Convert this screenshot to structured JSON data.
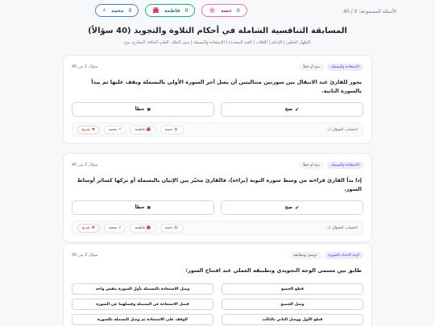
{
  "header": {
    "counter": "الأسئلة المسموعة: 0 / 40",
    "scores": [
      {
        "name": "محمد",
        "score": "0",
        "icon": "⚡",
        "cls": "pill-mohammed"
      },
      {
        "name": "فاطمة",
        "score": "0",
        "icon": "🌺",
        "cls": "pill-fatima"
      },
      {
        "name": "حصة",
        "score": "0",
        "icon": "🌸",
        "cls": "pill-hessa"
      }
    ]
  },
  "title": "المسابقة التنافسية الشاملة في أحكام التلاوة والتجويد (40 سؤالاً)",
  "subtitle": "الإظهار الحلقي | الإدغام | الإقلاب | الغنة المشددة | الاستعاذة والبسملة | سور الملك، القلم، الحاقة، المعارج، نوح",
  "award": {
    "label": "احتساب السؤال لـ:",
    "buttons": [
      {
        "label": "حصة",
        "icon": "🌸"
      },
      {
        "label": "فاطمة",
        "icon": "🌺"
      },
      {
        "label": "محمد",
        "icon": "⚡"
      },
      {
        "label": "تفريغ",
        "icon": "✖"
      }
    ]
  },
  "questions": [
    {
      "num": "سؤال 1 من 40",
      "category": "الاستعاذة والبسملة",
      "type": "صح أو خطأ",
      "text": "يجوز للقارئ عند الانتقال بين سورتين متتاليتين أن يصل آخر السورة الأولى بالبسملة ويقف عليها ثم يبدأ بالسورة الثانية.",
      "true_label": "صح",
      "false_label": "خطأ"
    },
    {
      "num": "سؤال 2 من 40",
      "category": "الاستعاذة والبسملة",
      "type": "صح أو خطأ",
      "text": "إذا بدأ القارئ قراءته من وسط سورة التوبة (براءة)، فالقارئ مخيّر بين الإتيان بالبسملة أو تركها كسائر أوساط السور.",
      "true_label": "صح",
      "false_label": "خطأ"
    },
    {
      "num": "سؤال 3 من 40",
      "category": "أوجه الابتداء بالسورة",
      "type": "توصيل ومطابقة",
      "text": "طابق بين مسمى الوجه التجويدي وتطبيقه العملي عند افتتاح السور:",
      "right_items": [
        "قطع الجميع",
        "وصل الجميع",
        "قطع الأول ووصل الثاني بالثالث"
      ],
      "left_items": [
        "وصل الاستعاذة بالبسملة بأول السورة بنفس واحد",
        "فصل الاستعاذة عن البسملة وفصلهما عن السورة",
        "الوقف على الاستعاذة ثم وصل البسملة بالسورة"
      ]
    }
  ]
}
